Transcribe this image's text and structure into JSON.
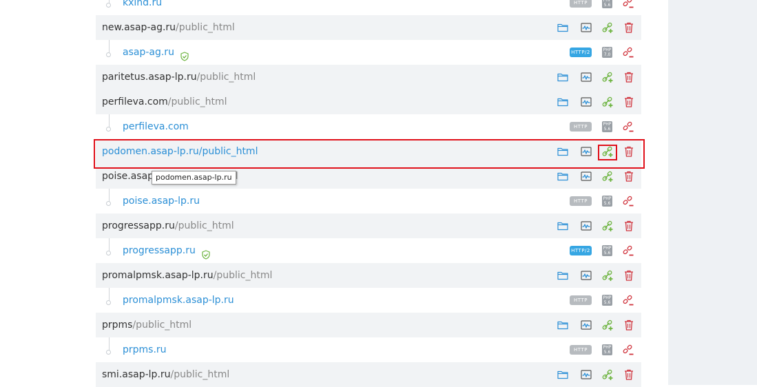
{
  "colors": {
    "link": "#2b8fd6",
    "site_row_bg": "#f1f3f5",
    "add_alias": "#6cb33e",
    "delete": "#d0333c",
    "http2_badge": "#36a6e3",
    "highlight": "#e0101a"
  },
  "rows": [
    {
      "type": "domain",
      "domain": "kxind.ru",
      "http_badge": "HTTP",
      "php_badge": [
        "PHP",
        "5.6"
      ],
      "ssl": false
    },
    {
      "type": "site",
      "host": "new.asap-ag.ru",
      "path": "/public_html"
    },
    {
      "type": "domain",
      "domain": "asap-ag.ru",
      "http_badge": "HTTP/2",
      "php_badge": [
        "PHP",
        "7.0"
      ],
      "ssl": true
    },
    {
      "type": "site",
      "host": "paritetus.asap-lp.ru",
      "path": "/public_html"
    },
    {
      "type": "site",
      "host": "perfileva.com",
      "path": "/public_html"
    },
    {
      "type": "domain",
      "domain": "perfileva.com",
      "http_badge": "HTTP",
      "php_badge": [
        "PHP",
        "5.6"
      ],
      "ssl": false
    },
    {
      "type": "site",
      "host": "podomen.asap-lp.ru",
      "path": "/public_html",
      "highlighted": true
    },
    {
      "type": "site",
      "host": "poise.asap-lp.ru",
      "path": "/public_html"
    },
    {
      "type": "domain",
      "domain": "poise.asap-lp.ru",
      "http_badge": "HTTP",
      "php_badge": [
        "PHP",
        "5.6"
      ],
      "ssl": false
    },
    {
      "type": "site",
      "host": "progressapp.ru",
      "path": "/public_html"
    },
    {
      "type": "domain",
      "domain": "progressapp.ru",
      "http_badge": "HTTP/2",
      "php_badge": [
        "PHP",
        "5.6"
      ],
      "ssl": true
    },
    {
      "type": "site",
      "host": "promalpmsk.asap-lp.ru",
      "path": "/public_html"
    },
    {
      "type": "domain",
      "domain": "promalpmsk.asap-lp.ru",
      "http_badge": "HTTP",
      "php_badge": [
        "PHP",
        "5.6"
      ],
      "ssl": false
    },
    {
      "type": "site",
      "host": "prpms",
      "path": "/public_html"
    },
    {
      "type": "domain",
      "domain": "prpms.ru",
      "http_badge": "HTTP",
      "php_badge": [
        "PHP",
        "5.6"
      ],
      "ssl": false
    },
    {
      "type": "site",
      "host": "smi.asap-lp.ru",
      "path": "/public_html"
    }
  ],
  "tooltip": {
    "text": "podomen.asap-lp.ru"
  }
}
